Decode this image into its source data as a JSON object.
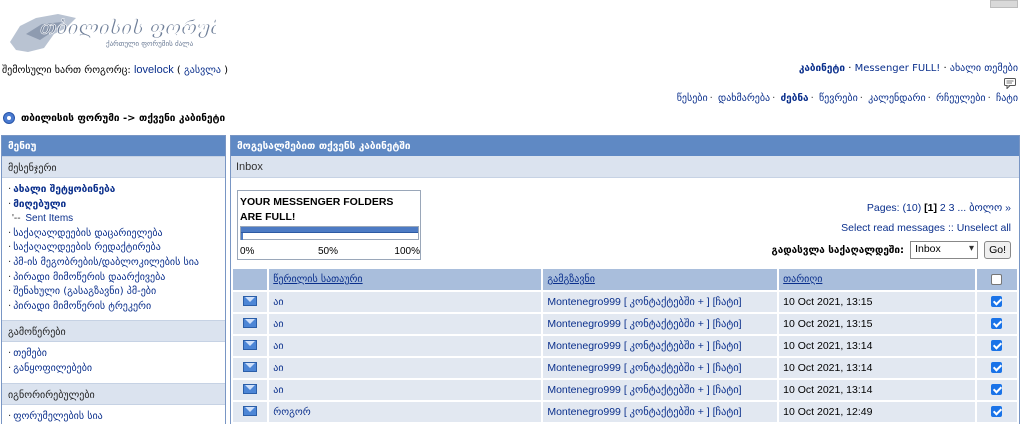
{
  "header": {
    "logo_main": "თბილისის ფორუმი",
    "logo_sub": "ქართული ფორუმის ძალა",
    "logged_in_label": "შემოსული ხართ როგორც:",
    "username": "lovelock",
    "logout_open": "(",
    "logout_label": "გასვლა",
    "logout_close": ")"
  },
  "userlinks": {
    "cabinet": "კაბინეტი",
    "messenger": "Messenger FULL!",
    "new_topics": "ახალი თემები"
  },
  "nav": {
    "rules": "წესები",
    "help": "დახმარება",
    "search": "ძებნა",
    "members": "წევრები",
    "calendar": "კალენდარი",
    "ratings": "რჩეულები",
    "chat": "ჩატი"
  },
  "breadcrumb": "თბილისის ფორუმი -> თქვენი კაბინეტი",
  "menu": {
    "title": "მენიუ",
    "sections": [
      {
        "title": "მესენჯერი",
        "items": [
          "ახალი შეტყობინება",
          "მიღებული",
          "Sent Items",
          "საქაღალდეების დაცარიელება",
          "საქაღალდეების რედაქტირება",
          "პმ-ის მეგობრების/დაბლოკილების სია",
          "პირადი მიმოწერის დაარქივება",
          "შენახული (გასაგზავნი) პმ-ები",
          "პირადი მიმოწერის ტრეკერი"
        ]
      },
      {
        "title": "გამოწერები",
        "items": [
          "თემები",
          "განყოფილებები"
        ]
      },
      {
        "title": "იგნორირებულები",
        "items": [
          "ფორუმელების სია"
        ]
      }
    ]
  },
  "main": {
    "title": "მოგესალმებით თქვენს კაბინეტში",
    "folder": "Inbox",
    "full_message": "YOUR MESSENGER FOLDERS ARE FULL!",
    "usage_percent": 100,
    "scale": [
      "0%",
      "50%",
      "100%"
    ],
    "pages_label": "Pages:",
    "pages_count": "(10)",
    "current_page": "[1]",
    "page_2": "2",
    "page_3": "3",
    "ellipsis": "...",
    "last_label": "ბოლო »",
    "select_read": "Select read messages",
    "select_sep": "::",
    "unselect_all": "Unselect all",
    "jump_label": "გადასვლა საქაღალდეში:",
    "jump_value": "Inbox",
    "go_label": "Go!"
  },
  "table": {
    "headers": {
      "subject": "წერილის სათაური",
      "sender": "გამგზავნი",
      "date": "თარიღი"
    },
    "rows": [
      {
        "subject": "აი",
        "sender": "Montenegro999 [ კონტაქტებში + ] [ჩატი]",
        "date": "10 Oct 2021, 13:15",
        "checked": true
      },
      {
        "subject": "აი",
        "sender": "Montenegro999 [ კონტაქტებში + ] [ჩატი]",
        "date": "10 Oct 2021, 13:15",
        "checked": true
      },
      {
        "subject": "აი",
        "sender": "Montenegro999 [ კონტაქტებში + ] [ჩატი]",
        "date": "10 Oct 2021, 13:14",
        "checked": true
      },
      {
        "subject": "აი",
        "sender": "Montenegro999 [ კონტაქტებში + ] [ჩატი]",
        "date": "10 Oct 2021, 13:14",
        "checked": true
      },
      {
        "subject": "აი",
        "sender": "Montenegro999 [ კონტაქტებში + ] [ჩატი]",
        "date": "10 Oct 2021, 13:14",
        "checked": true
      },
      {
        "subject": "როგორ",
        "sender": "Montenegro999 [ კონტაქტებში + ] [ჩატი]",
        "date": "10 Oct 2021, 12:49",
        "checked": true
      }
    ]
  },
  "colors": {
    "header_bar": "#5f89c4",
    "section_bg": "#dbe3ef",
    "link": "#0a2f8c",
    "checkbox": "#1a73e8"
  }
}
